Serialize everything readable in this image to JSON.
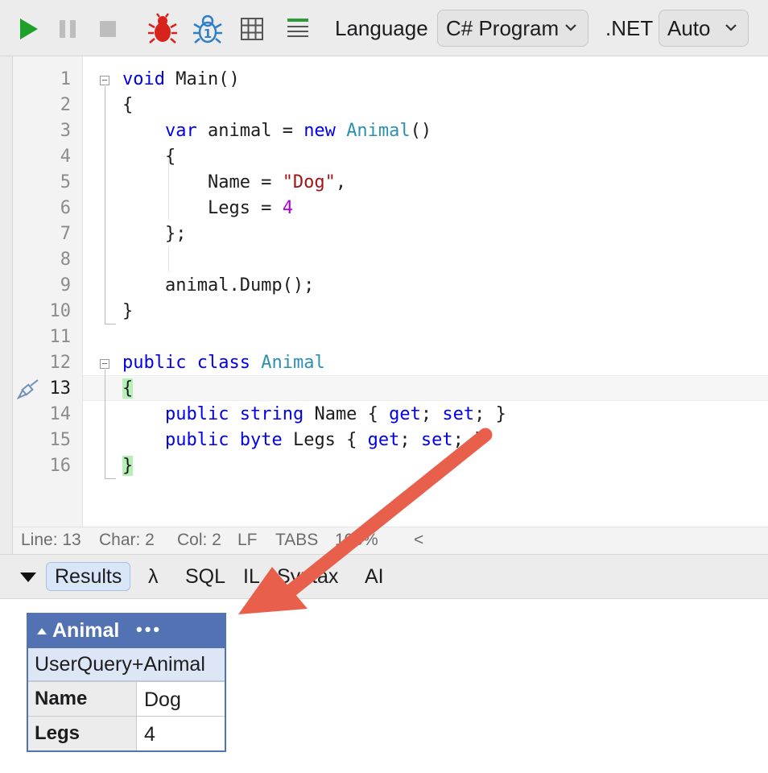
{
  "toolbar": {
    "run_icon": "play-icon",
    "pause_icon": "pause-icon",
    "stop_icon": "stop-icon",
    "debug_icon": "bug-icon",
    "debug_step_icon": "bug-step-icon",
    "grid_icon": "grid-icon",
    "text_icon": "lines-icon",
    "language_label": "Language",
    "language_value": "C# Program",
    "dotnet_label": ".NET",
    "dotnet_value": "Auto"
  },
  "editor": {
    "line_numbers": [
      "1",
      "2",
      "3",
      "4",
      "5",
      "6",
      "7",
      "8",
      "9",
      "10",
      "11",
      "12",
      "13",
      "14",
      "15",
      "16"
    ],
    "current_line": "13"
  },
  "statusbar": {
    "line": "Line: 13",
    "char": "Char: 2",
    "col": "Col: 2",
    "eol": "LF",
    "indent": "TABS",
    "zoom": "100%",
    "collapse": "<"
  },
  "tabs": {
    "results": "Results",
    "lambda": "λ",
    "sql": "SQL",
    "il": "IL",
    "syntax": "Syntax",
    "ai": "AI"
  },
  "results": {
    "header": "Animal",
    "header_menu": "•••",
    "type_name": "UserQuery+Animal",
    "rows": [
      {
        "key": "Name",
        "value": "Dog"
      },
      {
        "key": "Legs",
        "value": "4"
      }
    ]
  },
  "colors": {
    "keyword": "#0000ee",
    "type": "#2b91af",
    "string": "#a31515",
    "number": "#b000dd",
    "dump_header": "#5272b4",
    "arrow": "#e8604c"
  }
}
